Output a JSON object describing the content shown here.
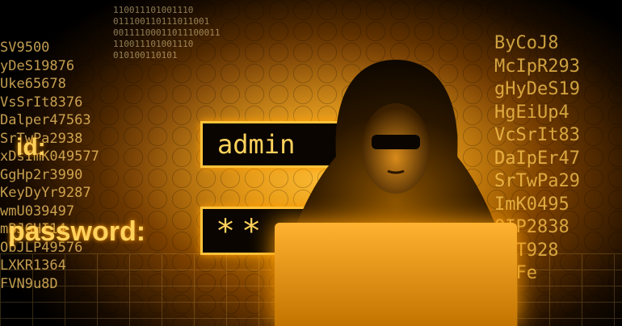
{
  "labels": {
    "id": "id:",
    "password": "password:"
  },
  "fields": {
    "username": "admin",
    "password": "**"
  },
  "left_column": [
    "SV9500",
    "yDeS19876",
    "Uke65678",
    "VsSrIt8376",
    "Dalper47563",
    "SrTwPa2938",
    "xDsImK049577",
    "GgHp2r3990",
    "KeyDyYr9287",
    "wmU039497",
    "mBJGHI14",
    "ObJLP49576",
    "LXKR1364",
    "FVN9u8D"
  ],
  "right_column": [
    "ByCoJ8",
    "McIpR293",
    "gHyDeS19",
    "HgEiUp4",
    "VcSrIt83",
    "DaIpEr47",
    "SrTwPa29",
    "ImK0495",
    "OIP2838",
    "UyT928",
    "HgFe"
  ],
  "binary": [
    "110011101001110",
    "011100110111011001",
    "00111100011011100011",
    "110011101001110",
    "010100110101"
  ],
  "accent": "#ffb21a"
}
